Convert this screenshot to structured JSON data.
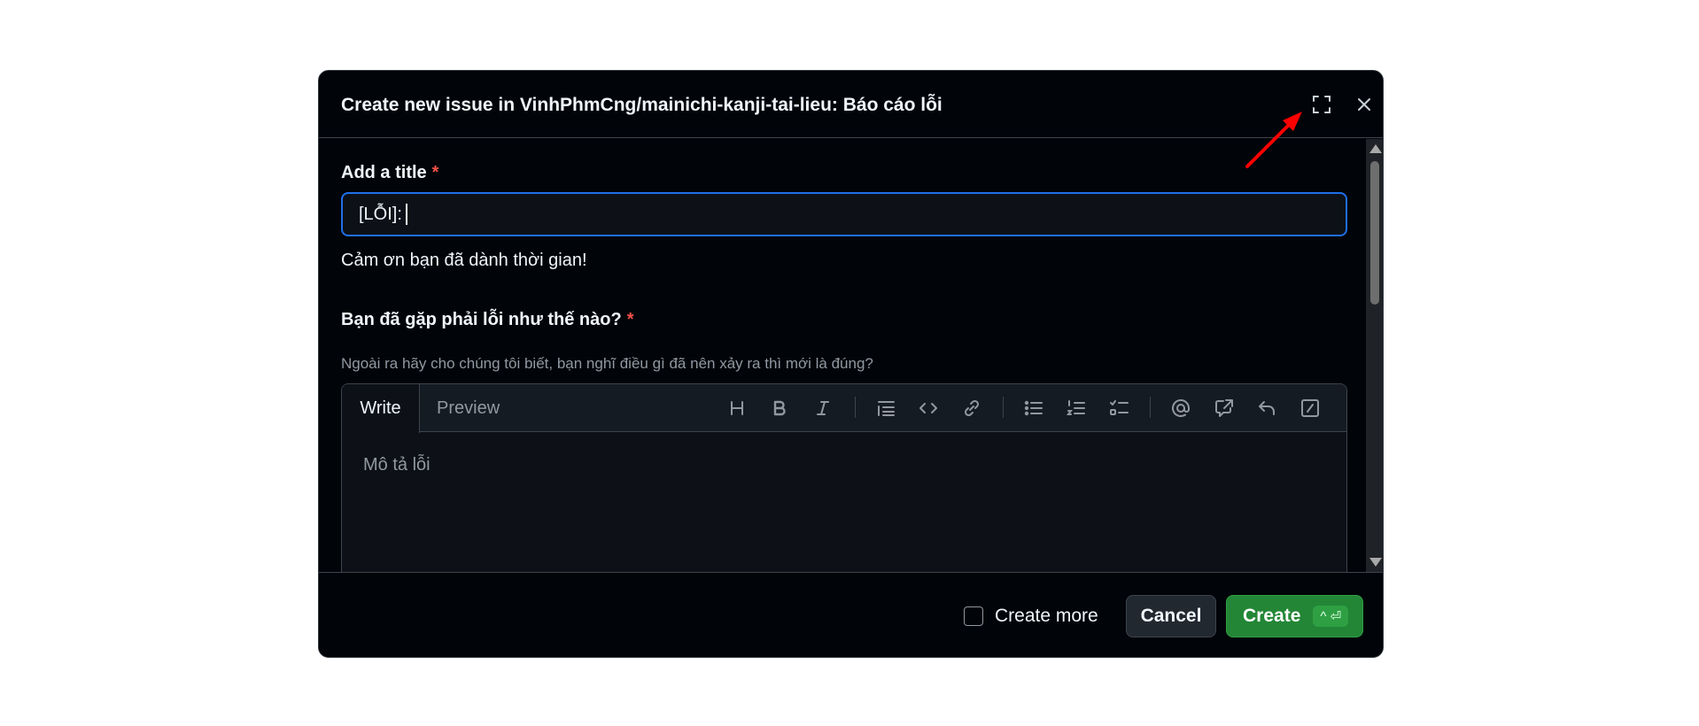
{
  "dialog": {
    "title": "Create new issue in VinhPhmCng/mainichi-kanji-tai-lieu: Báo cáo lỗi",
    "fullscreen_icon": "fullscreen-icon",
    "close_icon": "close-icon"
  },
  "form": {
    "title_label": "Add a title",
    "required_mark": "*",
    "title_value": "[LỖI]:",
    "thanks_text": "Cảm ơn bạn đã dành thời gian!",
    "question_label": "Bạn đã gặp phải lỗi như thế nào?",
    "question_hint": "Ngoài ra hãy cho chúng tôi biết, bạn nghĩ điều gì đã nên xảy ra thì mới là đúng?",
    "editor": {
      "tab_write": "Write",
      "tab_preview": "Preview",
      "placeholder": "Mô tả lỗi",
      "toolbar_icons": [
        "heading-icon",
        "bold-icon",
        "italic-icon",
        "quote-icon",
        "code-icon",
        "link-icon",
        "unordered-list-icon",
        "ordered-list-icon",
        "task-list-icon",
        "mention-icon",
        "reference-icon",
        "reply-icon",
        "slash-command-icon"
      ]
    }
  },
  "footer": {
    "create_more_label": "Create more",
    "cancel_label": "Cancel",
    "create_label": "Create",
    "create_shortcut": "^ ⏎"
  },
  "colors": {
    "background": "#010409",
    "accent_blue": "#1f6feb",
    "create_green": "#238636",
    "required_red": "#f85149",
    "annotation_arrow": "#ff0000"
  }
}
